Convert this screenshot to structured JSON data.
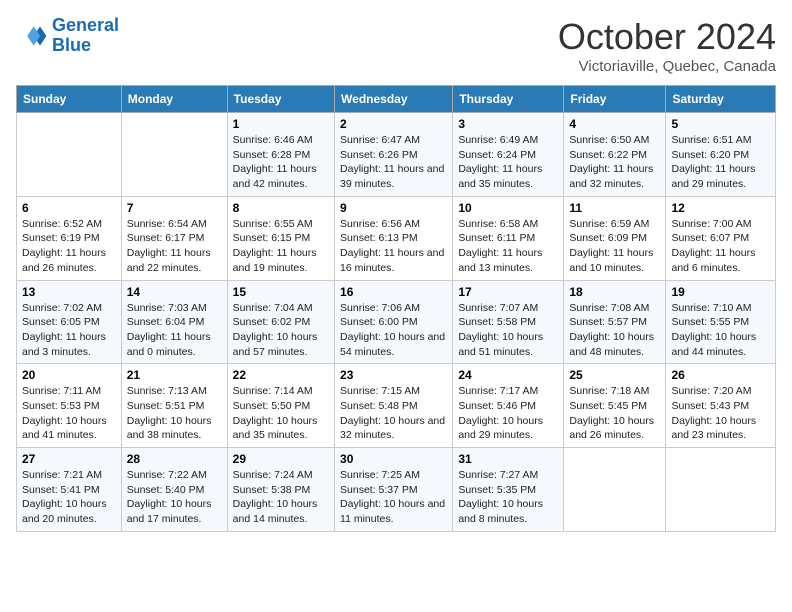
{
  "logo": {
    "line1": "General",
    "line2": "Blue"
  },
  "title": "October 2024",
  "location": "Victoriaville, Quebec, Canada",
  "days_of_week": [
    "Sunday",
    "Monday",
    "Tuesday",
    "Wednesday",
    "Thursday",
    "Friday",
    "Saturday"
  ],
  "weeks": [
    [
      {
        "day": "",
        "sunrise": "",
        "sunset": "",
        "daylight": ""
      },
      {
        "day": "",
        "sunrise": "",
        "sunset": "",
        "daylight": ""
      },
      {
        "day": "1",
        "sunrise": "Sunrise: 6:46 AM",
        "sunset": "Sunset: 6:28 PM",
        "daylight": "Daylight: 11 hours and 42 minutes."
      },
      {
        "day": "2",
        "sunrise": "Sunrise: 6:47 AM",
        "sunset": "Sunset: 6:26 PM",
        "daylight": "Daylight: 11 hours and 39 minutes."
      },
      {
        "day": "3",
        "sunrise": "Sunrise: 6:49 AM",
        "sunset": "Sunset: 6:24 PM",
        "daylight": "Daylight: 11 hours and 35 minutes."
      },
      {
        "day": "4",
        "sunrise": "Sunrise: 6:50 AM",
        "sunset": "Sunset: 6:22 PM",
        "daylight": "Daylight: 11 hours and 32 minutes."
      },
      {
        "day": "5",
        "sunrise": "Sunrise: 6:51 AM",
        "sunset": "Sunset: 6:20 PM",
        "daylight": "Daylight: 11 hours and 29 minutes."
      }
    ],
    [
      {
        "day": "6",
        "sunrise": "Sunrise: 6:52 AM",
        "sunset": "Sunset: 6:19 PM",
        "daylight": "Daylight: 11 hours and 26 minutes."
      },
      {
        "day": "7",
        "sunrise": "Sunrise: 6:54 AM",
        "sunset": "Sunset: 6:17 PM",
        "daylight": "Daylight: 11 hours and 22 minutes."
      },
      {
        "day": "8",
        "sunrise": "Sunrise: 6:55 AM",
        "sunset": "Sunset: 6:15 PM",
        "daylight": "Daylight: 11 hours and 19 minutes."
      },
      {
        "day": "9",
        "sunrise": "Sunrise: 6:56 AM",
        "sunset": "Sunset: 6:13 PM",
        "daylight": "Daylight: 11 hours and 16 minutes."
      },
      {
        "day": "10",
        "sunrise": "Sunrise: 6:58 AM",
        "sunset": "Sunset: 6:11 PM",
        "daylight": "Daylight: 11 hours and 13 minutes."
      },
      {
        "day": "11",
        "sunrise": "Sunrise: 6:59 AM",
        "sunset": "Sunset: 6:09 PM",
        "daylight": "Daylight: 11 hours and 10 minutes."
      },
      {
        "day": "12",
        "sunrise": "Sunrise: 7:00 AM",
        "sunset": "Sunset: 6:07 PM",
        "daylight": "Daylight: 11 hours and 6 minutes."
      }
    ],
    [
      {
        "day": "13",
        "sunrise": "Sunrise: 7:02 AM",
        "sunset": "Sunset: 6:05 PM",
        "daylight": "Daylight: 11 hours and 3 minutes."
      },
      {
        "day": "14",
        "sunrise": "Sunrise: 7:03 AM",
        "sunset": "Sunset: 6:04 PM",
        "daylight": "Daylight: 11 hours and 0 minutes."
      },
      {
        "day": "15",
        "sunrise": "Sunrise: 7:04 AM",
        "sunset": "Sunset: 6:02 PM",
        "daylight": "Daylight: 10 hours and 57 minutes."
      },
      {
        "day": "16",
        "sunrise": "Sunrise: 7:06 AM",
        "sunset": "Sunset: 6:00 PM",
        "daylight": "Daylight: 10 hours and 54 minutes."
      },
      {
        "day": "17",
        "sunrise": "Sunrise: 7:07 AM",
        "sunset": "Sunset: 5:58 PM",
        "daylight": "Daylight: 10 hours and 51 minutes."
      },
      {
        "day": "18",
        "sunrise": "Sunrise: 7:08 AM",
        "sunset": "Sunset: 5:57 PM",
        "daylight": "Daylight: 10 hours and 48 minutes."
      },
      {
        "day": "19",
        "sunrise": "Sunrise: 7:10 AM",
        "sunset": "Sunset: 5:55 PM",
        "daylight": "Daylight: 10 hours and 44 minutes."
      }
    ],
    [
      {
        "day": "20",
        "sunrise": "Sunrise: 7:11 AM",
        "sunset": "Sunset: 5:53 PM",
        "daylight": "Daylight: 10 hours and 41 minutes."
      },
      {
        "day": "21",
        "sunrise": "Sunrise: 7:13 AM",
        "sunset": "Sunset: 5:51 PM",
        "daylight": "Daylight: 10 hours and 38 minutes."
      },
      {
        "day": "22",
        "sunrise": "Sunrise: 7:14 AM",
        "sunset": "Sunset: 5:50 PM",
        "daylight": "Daylight: 10 hours and 35 minutes."
      },
      {
        "day": "23",
        "sunrise": "Sunrise: 7:15 AM",
        "sunset": "Sunset: 5:48 PM",
        "daylight": "Daylight: 10 hours and 32 minutes."
      },
      {
        "day": "24",
        "sunrise": "Sunrise: 7:17 AM",
        "sunset": "Sunset: 5:46 PM",
        "daylight": "Daylight: 10 hours and 29 minutes."
      },
      {
        "day": "25",
        "sunrise": "Sunrise: 7:18 AM",
        "sunset": "Sunset: 5:45 PM",
        "daylight": "Daylight: 10 hours and 26 minutes."
      },
      {
        "day": "26",
        "sunrise": "Sunrise: 7:20 AM",
        "sunset": "Sunset: 5:43 PM",
        "daylight": "Daylight: 10 hours and 23 minutes."
      }
    ],
    [
      {
        "day": "27",
        "sunrise": "Sunrise: 7:21 AM",
        "sunset": "Sunset: 5:41 PM",
        "daylight": "Daylight: 10 hours and 20 minutes."
      },
      {
        "day": "28",
        "sunrise": "Sunrise: 7:22 AM",
        "sunset": "Sunset: 5:40 PM",
        "daylight": "Daylight: 10 hours and 17 minutes."
      },
      {
        "day": "29",
        "sunrise": "Sunrise: 7:24 AM",
        "sunset": "Sunset: 5:38 PM",
        "daylight": "Daylight: 10 hours and 14 minutes."
      },
      {
        "day": "30",
        "sunrise": "Sunrise: 7:25 AM",
        "sunset": "Sunset: 5:37 PM",
        "daylight": "Daylight: 10 hours and 11 minutes."
      },
      {
        "day": "31",
        "sunrise": "Sunrise: 7:27 AM",
        "sunset": "Sunset: 5:35 PM",
        "daylight": "Daylight: 10 hours and 8 minutes."
      },
      {
        "day": "",
        "sunrise": "",
        "sunset": "",
        "daylight": ""
      },
      {
        "day": "",
        "sunrise": "",
        "sunset": "",
        "daylight": ""
      }
    ]
  ]
}
